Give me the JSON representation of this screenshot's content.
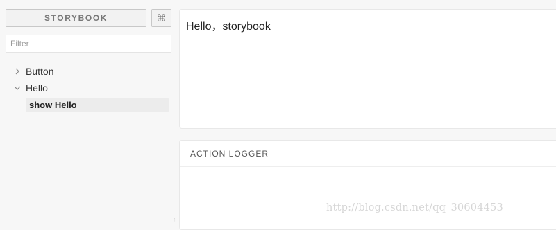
{
  "sidebar": {
    "brand_label": "STORYBOOK",
    "shortcut_label": "⌘",
    "filter_placeholder": "Filter",
    "tree": [
      {
        "label": "Button",
        "expanded": false
      },
      {
        "label": "Hello",
        "expanded": true,
        "stories": [
          "show Hello"
        ]
      }
    ]
  },
  "preview": {
    "text": "Hello，storybook"
  },
  "action_logger": {
    "title": "ACTION LOGGER"
  },
  "watermark": "http://blog.csdn.net/qq_30604453"
}
